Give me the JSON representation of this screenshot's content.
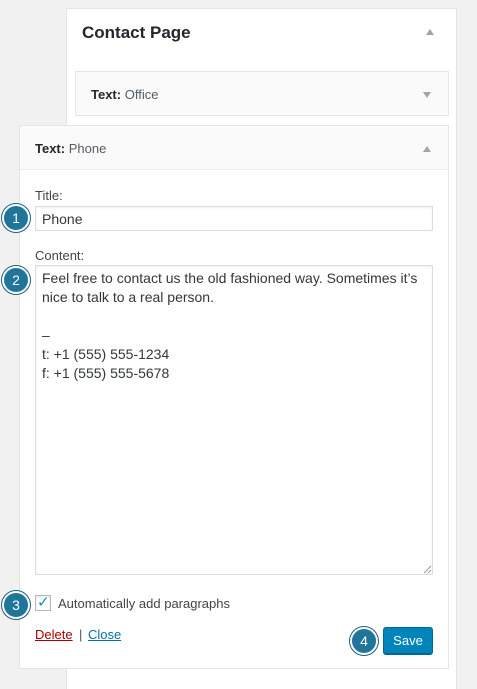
{
  "outer_panel": {
    "title": "Contact Page"
  },
  "widget_office": {
    "type_label": "Text:",
    "name": "Office"
  },
  "widget_phone": {
    "type_label": "Text:",
    "name": "Phone",
    "title_label": "Title:",
    "title_value": "Phone",
    "content_label": "Content:",
    "content_value": "Feel free to contact us the old fashioned way. Sometimes it’s nice to talk to a real person.\n\n–\nt: +1 (555) 555-1234\nf: +1 (555) 555-5678",
    "auto_paragraphs_label": "Automatically add paragraphs",
    "auto_paragraphs_checked": true,
    "delete_label": "Delete",
    "separator": "|",
    "close_label": "Close",
    "save_label": "Save"
  },
  "callouts": [
    "1",
    "2",
    "3",
    "4"
  ],
  "colors": {
    "primary_button": "#0085ba",
    "callout": "#21759b",
    "delete_link": "#a00",
    "close_link": "#0073aa"
  },
  "icons": {
    "collapse": "triangle-up-icon",
    "expand": "triangle-down-icon",
    "check": "check-icon",
    "resize": "resize-grip-icon"
  }
}
